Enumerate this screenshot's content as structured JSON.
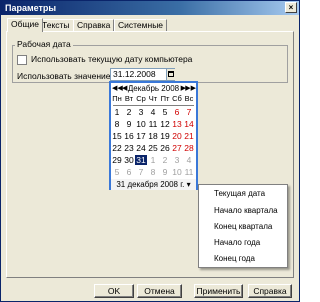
{
  "window": {
    "title": "Параметры",
    "close_glyph": "×"
  },
  "tabs": [
    "Общие",
    "Тексты",
    "Справка",
    "Системные"
  ],
  "group": {
    "title": "Рабочая дата",
    "checkbox_label": "Использовать текущую дату компьютера",
    "checkbox_checked": false,
    "value_label": "Использовать значение:",
    "value": "31.12.2008"
  },
  "calendar": {
    "nav_prev_year": "◀◀",
    "nav_prev": "◀",
    "month": "Декабрь 2008",
    "nav_next": "▶",
    "nav_next_year": "▶▶",
    "weekdays": [
      "Пн",
      "Вт",
      "Ср",
      "Чт",
      "Пт",
      "Сб",
      "Вс"
    ],
    "weeks": [
      [
        "1",
        "2",
        "3",
        "4",
        "5",
        "6",
        "7"
      ],
      [
        "8",
        "9",
        "10",
        "11",
        "12",
        "13",
        "14"
      ],
      [
        "15",
        "16",
        "17",
        "18",
        "19",
        "20",
        "21"
      ],
      [
        "22",
        "23",
        "24",
        "25",
        "26",
        "27",
        "28"
      ],
      [
        "29",
        "30",
        "31",
        "1",
        "2",
        "3",
        "4"
      ],
      [
        "5",
        "6",
        "7",
        "8",
        "9",
        "10",
        "11"
      ]
    ],
    "selected_day": "31",
    "today_text": "31 декабря 2008 г.",
    "today_arrow": "▾"
  },
  "context_menu": [
    "Текущая дата",
    "Начало квартала",
    "Конец квартала",
    "Начало года",
    "Конец года"
  ],
  "buttons": {
    "ok": "OK",
    "cancel": "Отмена",
    "apply": "Применить",
    "help": "Справка"
  },
  "colors": {
    "title_start": "#0a246a",
    "weekend": "#d00000",
    "selection": "#0a246a",
    "calendar_border": "#3a78d8"
  }
}
